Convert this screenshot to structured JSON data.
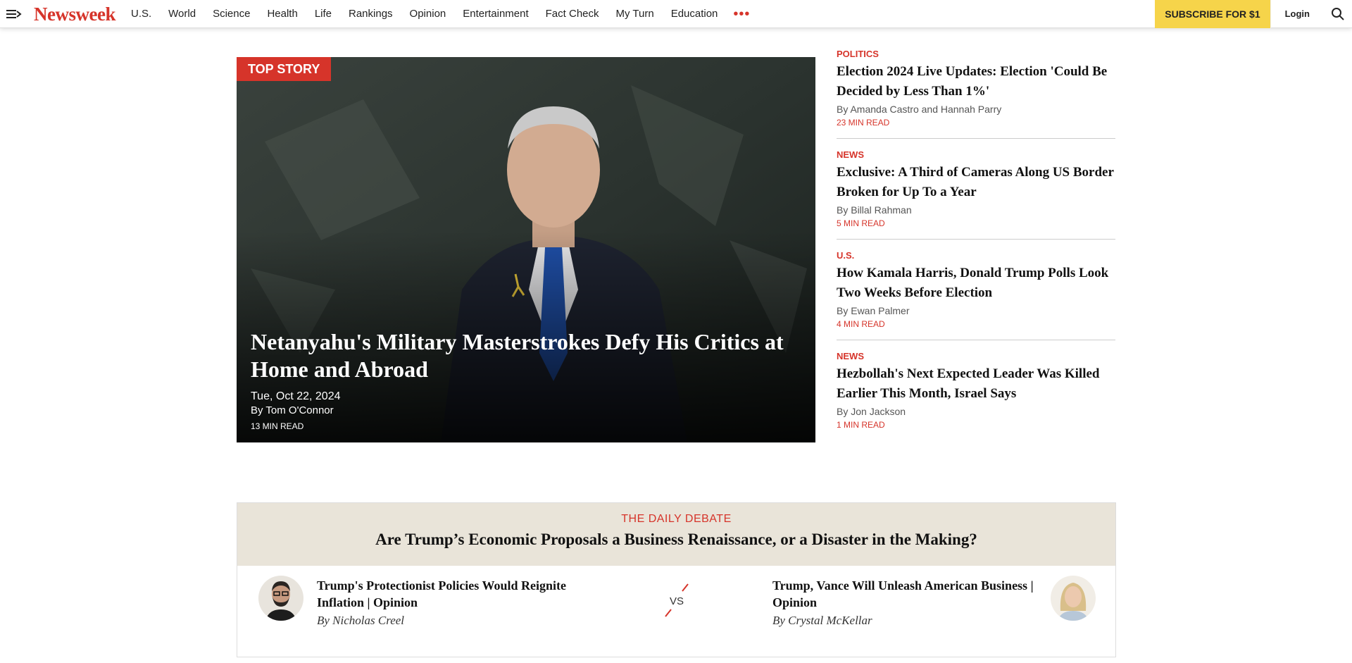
{
  "header": {
    "logo": "Newsweek",
    "nav": [
      "U.S.",
      "World",
      "Science",
      "Health",
      "Life",
      "Rankings",
      "Opinion",
      "Entertainment",
      "Fact Check",
      "My Turn",
      "Education"
    ],
    "more_icon": "ellipsis-icon",
    "subscribe_label": "SUBSCRIBE FOR $1",
    "login_label": "Login",
    "icons": {
      "menu": "menu-icon",
      "search": "search-icon"
    }
  },
  "top_story": {
    "badge": "TOP STORY",
    "title": "Netanyahu's Military Masterstrokes Defy His Critics at Home and Abroad",
    "date": "Tue, Oct 22, 2024",
    "author": "By Tom O'Connor",
    "read_time": "13 MIN READ"
  },
  "side_stories": [
    {
      "category": "POLITICS",
      "title": "Election 2024 Live Updates: Election 'Could Be Decided by Less Than 1%'",
      "author": "By Amanda Castro",
      "coauthor": "and Hannah Parry",
      "read_time": "23 MIN READ"
    },
    {
      "category": "NEWS",
      "title": "Exclusive: A Third of Cameras Along US Border Broken for Up To a Year",
      "author": "By Billal Rahman",
      "coauthor": "",
      "read_time": "5 MIN READ"
    },
    {
      "category": "U.S.",
      "title": "How Kamala Harris, Donald Trump Polls Look Two Weeks Before Election",
      "author": "By Ewan Palmer",
      "coauthor": "",
      "read_time": "4 MIN READ"
    },
    {
      "category": "NEWS",
      "title": "Hezbollah's Next Expected Leader Was Killed Earlier This Month, Israel Says",
      "author": "By Jon Jackson",
      "coauthor": "",
      "read_time": "1 MIN READ"
    }
  ],
  "debate": {
    "label": "THE DAILY DEBATE",
    "question": "Are Trump’s Economic Proposals a Business Renaissance, or a Disaster in the Making?",
    "vs": "VS",
    "left": {
      "title": "Trump's Protectionist Policies Would Reignite Inflation | Opinion",
      "author": "By Nicholas Creel"
    },
    "right": {
      "title": "Trump, Vance Will Unleash American Business | Opinion",
      "author": "By Crystal McKellar"
    }
  },
  "colors": {
    "brand": "#d6342a",
    "subscribe": "#f6d44a",
    "debate_bg": "#e9e4d9"
  }
}
